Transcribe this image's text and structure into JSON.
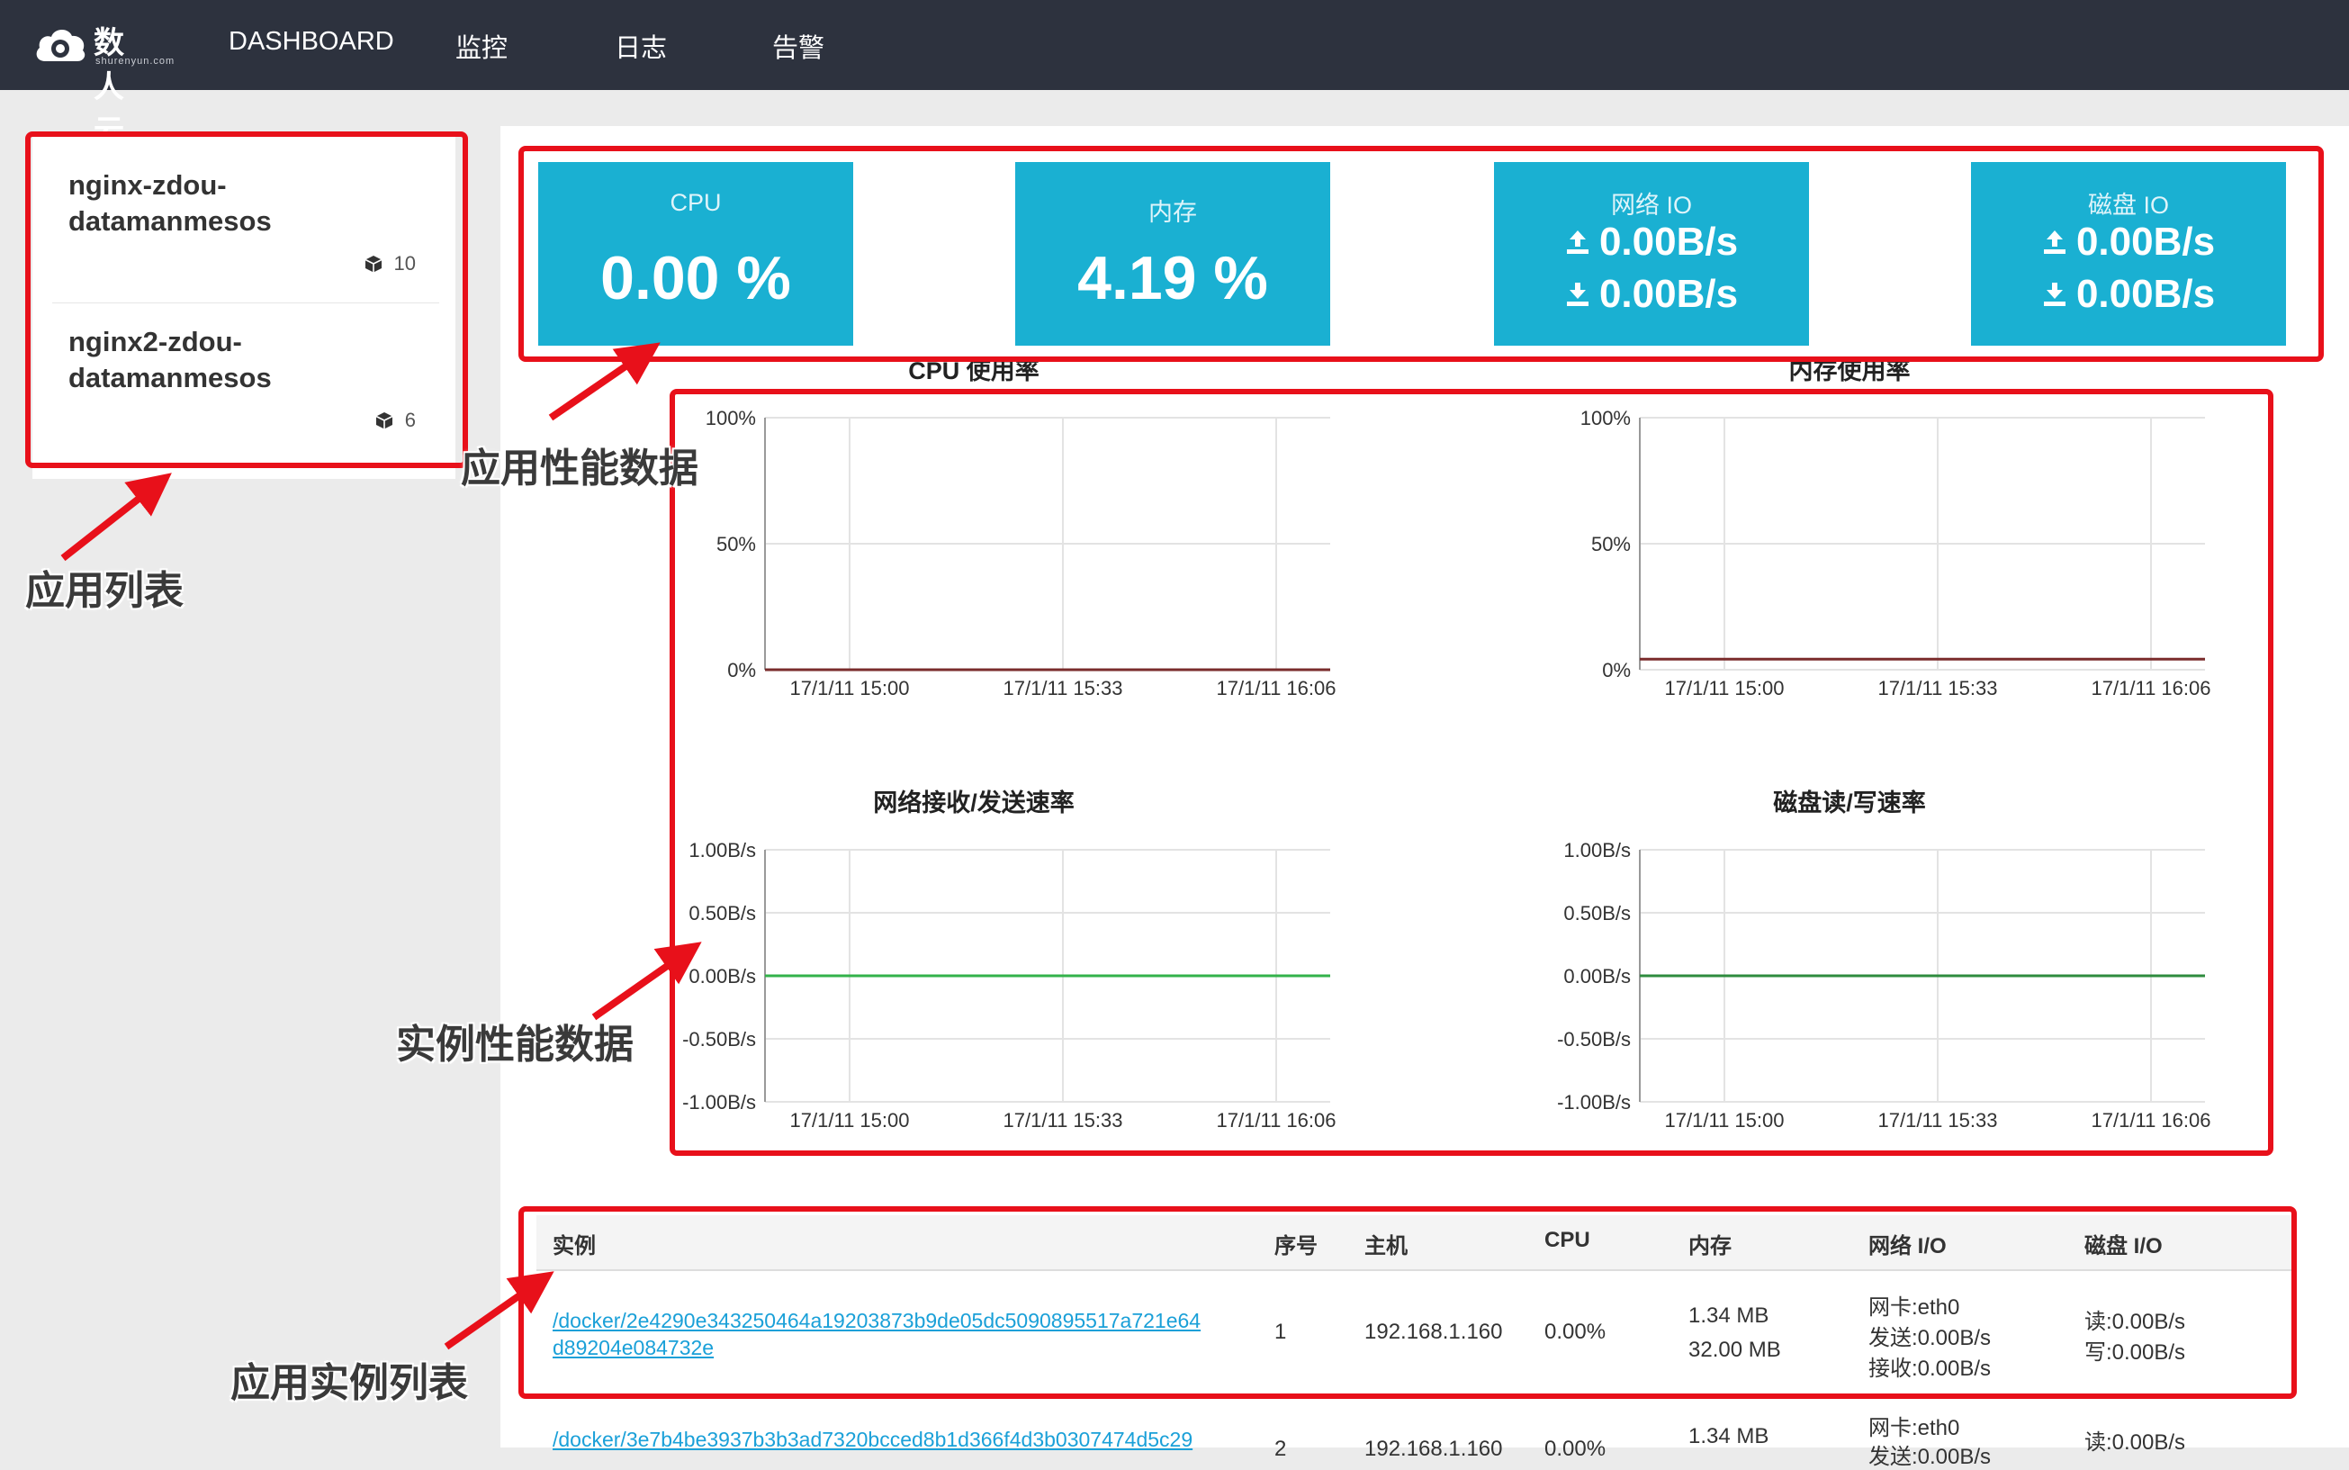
{
  "nav": {
    "logo_text": "数人云",
    "logo_sub": "shurenyun.com",
    "items": [
      "DASHBOARD",
      "监控",
      "日志",
      "告警"
    ]
  },
  "sidebar": {
    "apps": [
      {
        "name": "nginx-zdou-datamanmesos",
        "count": "10"
      },
      {
        "name": "nginx2-zdou-datamanmesos",
        "count": "6"
      }
    ]
  },
  "stats": {
    "cpu": {
      "title": "CPU",
      "value": "0.00 %"
    },
    "mem": {
      "title": "内存",
      "value": "4.19 %"
    },
    "net": {
      "title": "网络 IO",
      "up": "0.00B/s",
      "down": "0.00B/s"
    },
    "disk": {
      "title": "磁盘 IO",
      "up": "0.00B/s",
      "down": "0.00B/s"
    }
  },
  "chart_data": [
    {
      "type": "line",
      "title": "CPU 使用率",
      "x": [
        "17/1/11 15:00",
        "17/1/11 15:33",
        "17/1/11 16:06"
      ],
      "yticks": [
        "100%",
        "50%",
        "0%"
      ],
      "ylim": [
        0,
        100
      ],
      "series": [
        {
          "values": [
            0,
            0,
            0
          ],
          "color": "#7a2c2c"
        }
      ]
    },
    {
      "type": "line",
      "title": "内存使用率",
      "x": [
        "17/1/11 15:00",
        "17/1/11 15:33",
        "17/1/11 16:06"
      ],
      "yticks": [
        "100%",
        "50%",
        "0%"
      ],
      "ylim": [
        0,
        100
      ],
      "series": [
        {
          "values": [
            4.19,
            4.19,
            4.19
          ],
          "color": "#7a2c2c"
        }
      ]
    },
    {
      "type": "line",
      "title": "网络接收/发送速率",
      "x": [
        "17/1/11 15:00",
        "17/1/11 15:33",
        "17/1/11 16:06"
      ],
      "yticks": [
        "1.00B/s",
        "0.50B/s",
        "0.00B/s",
        "-0.50B/s",
        "-1.00B/s"
      ],
      "ylim": [
        -1,
        1
      ],
      "series": [
        {
          "values": [
            0,
            0,
            0
          ],
          "color": "#33b24a"
        }
      ]
    },
    {
      "type": "line",
      "title": "磁盘读/写速率",
      "x": [
        "17/1/11 15:00",
        "17/1/11 15:33",
        "17/1/11 16:06"
      ],
      "yticks": [
        "1.00B/s",
        "0.50B/s",
        "0.00B/s",
        "-0.50B/s",
        "-1.00B/s"
      ],
      "ylim": [
        -1,
        1
      ],
      "series": [
        {
          "values": [
            0,
            0,
            0
          ],
          "color": "#2e8b3e"
        }
      ]
    }
  ],
  "table": {
    "headers": [
      "实例",
      "序号",
      "主机",
      "CPU",
      "内存",
      "网络 I/O",
      "磁盘 I/O"
    ],
    "rows": [
      {
        "instance": "/docker/2e4290e343250464a19203873b9de05dc5090895517a721e64d89204e084732e",
        "instance_l1": "/docker/2e4290e343250464a19203873b9de05dc5090895517a721e64",
        "instance_l2": "d89204e084732e",
        "index": "1",
        "host": "192.168.1.160",
        "cpu": "0.00%",
        "mem1": "1.34 MB",
        "mem2": "32.00 MB",
        "net1": "网卡:eth0",
        "net2": "发送:0.00B/s",
        "net3": "接收:0.00B/s",
        "disk1": "读:0.00B/s",
        "disk2": "写:0.00B/s"
      },
      {
        "instance_l1": "/docker/3e7b4be3937b3b3ad7320bcced8b1d366f4d3b0307474d5c29",
        "index": "2",
        "host": "192.168.1.160",
        "cpu": "0.00%",
        "mem1": "1.34 MB",
        "net1": "网卡:eth0",
        "net2": "发送:0.00B/s",
        "disk1": "读:0.00B/s"
      }
    ]
  },
  "annotations": {
    "app_list": "应用列表",
    "app_perf": "应用性能数据",
    "inst_perf": "实例性能数据",
    "inst_list": "应用实例列表"
  },
  "colors": {
    "navbar": "#2d323e",
    "accent": "#1ab0d2",
    "annotation_red": "#e8101a",
    "link": "#1aa0d8"
  }
}
